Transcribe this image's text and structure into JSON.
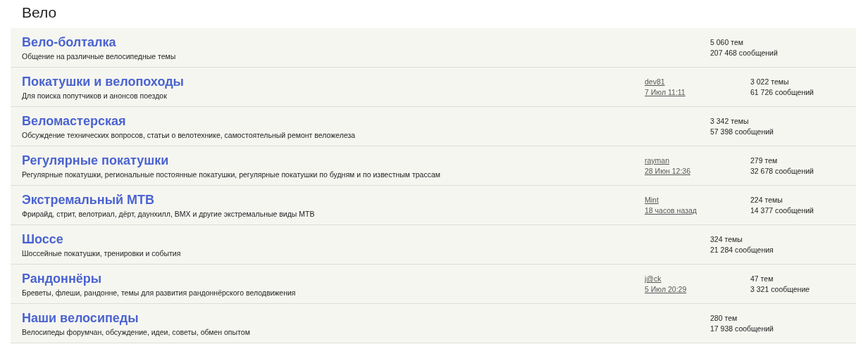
{
  "section_title": "Вело",
  "forums": [
    {
      "title": "Вело-болталка",
      "description": "Общение на различные велосипедные темы",
      "topics": "5 060 тем",
      "posts": "207 468 сообщений"
    },
    {
      "title": "Покатушки и велопоходы",
      "description": "Для поиска попутчиков и анонсов поездок",
      "last_post": {
        "author": "dev81",
        "time": "7 Июл 11:11"
      },
      "topics": "3 022 темы",
      "posts": "61 726 сообщений"
    },
    {
      "title": "Веломастерская",
      "description": "Обсуждение технических вопросов, статьи о велотехнике, самостоятельный ремонт веложелеза",
      "topics": "3 342 темы",
      "posts": "57 398 сообщений"
    },
    {
      "title": "Регулярные покатушки",
      "description": "Регулярные покатушки, региональные постоянные покатушки, регулярные покатушки по будням и по известным трассам",
      "last_post": {
        "author": "rayman",
        "time": "28 Июн 12:36"
      },
      "topics": "279 тем",
      "posts": "32 678 сообщений"
    },
    {
      "title": "Экстремальный MTB",
      "description": "Фрирайд, стрит, велотриал, дёрт, даунхилл, BMX и другие экстремальные виды MTB",
      "last_post": {
        "author": "Mint",
        "time": "18 часов назад"
      },
      "topics": "224 темы",
      "posts": "14 377 сообщений"
    },
    {
      "title": "Шоссе",
      "description": "Шоссейные покатушки, тренировки и события",
      "topics": "324 темы",
      "posts": "21 284 сообщения"
    },
    {
      "title": "Рандоннёры",
      "description": "Бреветы, флеши, рандонне, темы для развития рандоннёрского велодвижения",
      "last_post": {
        "author": "j@ck",
        "time": "5 Июл 20:29"
      },
      "topics": "47 тем",
      "posts": "3 321 сообщение"
    },
    {
      "title": "Наши велосипеды",
      "description": "Велосипеды форумчан, обсуждение, идеи, советы, обмен опытом",
      "topics": "280 тем",
      "posts": "17 938 сообщений"
    }
  ]
}
